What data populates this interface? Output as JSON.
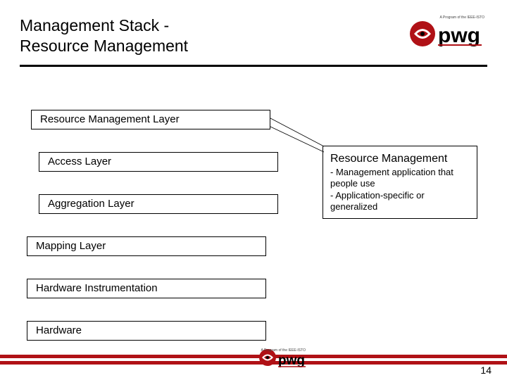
{
  "title_line1": "Management Stack -",
  "title_line2": "Resource Management",
  "layers": {
    "resource_mgmt": "Resource Management Layer",
    "access": "Access Layer",
    "aggregation": "Aggregation Layer",
    "mapping": "Mapping Layer",
    "hw_instrument": "Hardware Instrumentation",
    "hardware": "Hardware"
  },
  "callout": {
    "title": "Resource Management",
    "line1": "- Management application that people use",
    "line2": "- Application-specific or generalized"
  },
  "logo_text": "pwg",
  "logo_tagline": "A Program of the IEEE-ISTO",
  "page_number": "14",
  "colors": {
    "brand_red": "#b01116"
  }
}
